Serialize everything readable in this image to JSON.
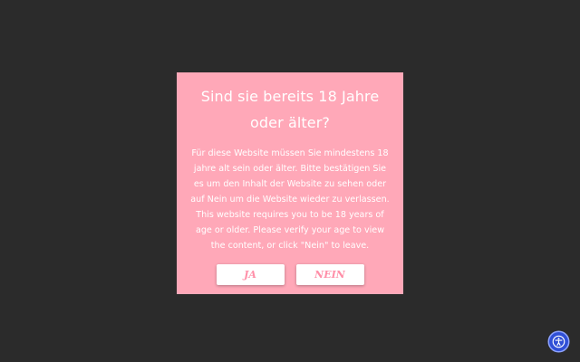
{
  "age_gate": {
    "title": "Sind sie bereits 18 Jahre oder älter?",
    "message": "Für diese Website müssen Sie mindestens 18 jahre alt sein oder älter. Bitte bestätigen Sie es um den Inhalt der Website zu sehen oder auf Nein um die Website wieder zu verlassen. This website requires you to be 18 years of age or older. Please verify your age to view the content, or click \"Nein\" to leave.",
    "yes_label": "JA",
    "no_label": "NEIN"
  },
  "accessibility": {
    "icon": "accessibility-icon"
  },
  "colors": {
    "background": "#2b2b2b",
    "modal": "#ffa8b8",
    "button_text": "#ff8fa8",
    "accessibility_button": "#2f4fd6"
  }
}
